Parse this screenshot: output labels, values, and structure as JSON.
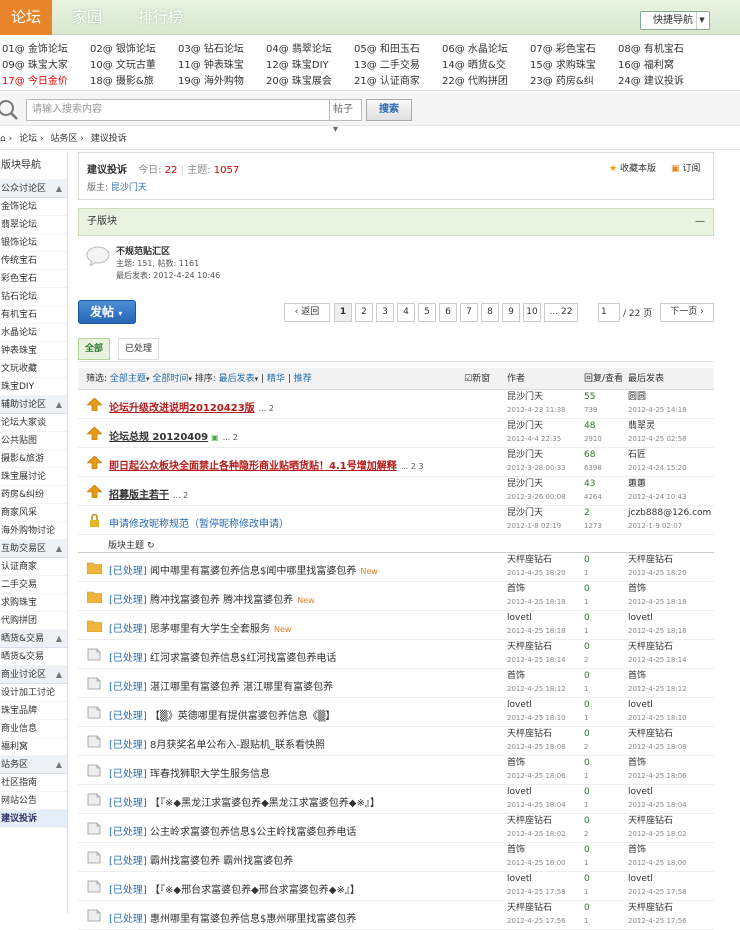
{
  "topnav": {
    "tabs": [
      "论坛",
      "家园",
      "排行榜"
    ],
    "quick_nav": "快捷导航"
  },
  "forum_grid": [
    [
      "01@ 金饰论坛",
      "02@ 银饰论坛",
      "03@ 钻石论坛",
      "04@ 翡翠论坛",
      "05@ 和田玉石",
      "06@ 水晶论坛",
      "07@ 彩色宝石",
      "08@ 有机宝石"
    ],
    [
      "09@ 珠宝大家",
      "10@ 文玩古董",
      "11@ 钟表珠宝",
      "12@ 珠宝DIY",
      "13@ 二手交易",
      "14@ 晒货&交",
      "15@ 求购珠宝",
      "16@ 福利窝"
    ],
    [
      "17@ 今日金价",
      "18@ 摄影&旅",
      "19@ 海外购物",
      "20@ 珠宝展会",
      "21@ 认证商家",
      "22@ 代购拼团",
      "23@ 药房&纠",
      "24@ 建议投诉"
    ]
  ],
  "search": {
    "placeholder": "请输入搜索内容",
    "select": "帖子",
    "button": "搜索"
  },
  "breadcrumb": [
    "论坛",
    "站务区",
    "建议投诉"
  ],
  "sidebar": [
    {
      "t": "版块导航",
      "k": "title"
    },
    {
      "t": "公众讨论区",
      "k": "head"
    },
    {
      "t": "金饰论坛"
    },
    {
      "t": "翡翠论坛"
    },
    {
      "t": "银饰论坛"
    },
    {
      "t": "传统宝石"
    },
    {
      "t": "彩色宝石"
    },
    {
      "t": "钻石论坛"
    },
    {
      "t": "有机宝石"
    },
    {
      "t": "水晶论坛"
    },
    {
      "t": "钟表珠宝"
    },
    {
      "t": "文玩收藏"
    },
    {
      "t": "珠宝DIY"
    },
    {
      "t": "辅助讨论区",
      "k": "head"
    },
    {
      "t": "论坛大家谈"
    },
    {
      "t": "公共贴图"
    },
    {
      "t": "摄影&旅游"
    },
    {
      "t": "珠宝展讨论"
    },
    {
      "t": "药房&纠纷"
    },
    {
      "t": "商家风采"
    },
    {
      "t": "海外购物讨论"
    },
    {
      "t": "互助交易区",
      "k": "head"
    },
    {
      "t": "认证商家"
    },
    {
      "t": "二手交易"
    },
    {
      "t": "求购珠宝"
    },
    {
      "t": "代购拼团"
    },
    {
      "t": "晒货&交易",
      "k": "head"
    },
    {
      "t": "晒货&交易"
    },
    {
      "t": "商业讨论区",
      "k": "head"
    },
    {
      "t": "设计加工讨论"
    },
    {
      "t": "珠宝品牌"
    },
    {
      "t": "商业信息"
    },
    {
      "t": "福利窝"
    },
    {
      "t": "站务区",
      "k": "head"
    },
    {
      "t": "社区指南"
    },
    {
      "t": "网站公告"
    },
    {
      "t": "建议投诉",
      "k": "sel"
    }
  ],
  "forum_info": {
    "title": "建议投诉",
    "today_label": "今日:",
    "today": "22",
    "topics_label": "主题:",
    "topics": "1057",
    "moderator_label": "版主:",
    "moderator": "昆沙门天",
    "favorite": "收藏本版",
    "subscribe": "订阅"
  },
  "subforum": {
    "header": "子版块",
    "name": "不规范贴汇区",
    "stats": "主题: 151, 帖数: 1161",
    "last": "最后发表: 2012-4-24 10:46"
  },
  "pager": {
    "post_button": "发帖",
    "back": "返回",
    "pages": [
      "1",
      "2",
      "3",
      "4",
      "5",
      "6",
      "7",
      "8",
      "9",
      "10",
      "... 22"
    ],
    "current_input": "1",
    "total": "/ 22 页",
    "next": "下一页"
  },
  "tabs": [
    "全部",
    "已处理"
  ],
  "table_header": {
    "filter": "筛选:",
    "all_topics": "全部主题",
    "all_time": "全部时间",
    "sort": "排序:",
    "sort_by": "最后发表",
    "digest": "精华",
    "recommend": "推荐",
    "new_window": "新窗",
    "author": "作者",
    "reply_view": "回复/查看",
    "last_post": "最后发表"
  },
  "sticky": [
    {
      "title": "论坛升级改进说明20120423版",
      "style": "stick",
      "pages": "... 2",
      "author": "昆沙门天",
      "date": "2012-4-23 11:38",
      "replies": "55",
      "views": "739",
      "last": "圆圆",
      "last_date": "2012-4-25 14:18"
    },
    {
      "title": "论坛总规 20120409",
      "style": "stick2",
      "pages": "... 2",
      "author": "昆沙门天",
      "date": "2012-4-4 22:35",
      "replies": "48",
      "views": "2910",
      "last": "翡翠灵",
      "last_date": "2012-4-25 02:58"
    },
    {
      "title": "即日起公众板块全面禁止各种隐形商业贴晒货贴！4.1号增加解释",
      "style": "stick",
      "pages": "... 2  3",
      "author": "昆沙门天",
      "date": "2012-3-28 00:33",
      "replies": "68",
      "views": "6398",
      "last": "石匠",
      "last_date": "2012-4-24 15:20"
    },
    {
      "title": "招募版主若干",
      "style": "stick2",
      "pages": "... 2",
      "author": "昆沙门天",
      "date": "2012-3-26 00:08",
      "replies": "43",
      "views": "4264",
      "last": "蕙蕙",
      "last_date": "2012-4-24 10:43"
    },
    {
      "title": "申请修改昵称规范（暂停昵称修改申请）",
      "style": "blueT",
      "pages": "",
      "author": "昆沙门天",
      "date": "2012-1-8 02:19",
      "replies": "2",
      "views": "1273",
      "last": "jczb888@126.com",
      "last_date": "2012-1-9 02:07"
    }
  ],
  "section_label": "版块主题",
  "threads": [
    {
      "cat": "[已处理]",
      "title": "闻中哪里有富婆包养信息$闻中哪里找富婆包养",
      "new": "New",
      "author": "天枰座钻石",
      "date": "2012-4-25 18:20",
      "replies": "0",
      "views": "1",
      "last": "天枰座钻石",
      "last_date": "2012-4-25 18:20",
      "hot": true
    },
    {
      "cat": "[已处理]",
      "title": "腾冲找富婆包养 腾冲找富婆包养",
      "new": "New",
      "author": "首饰",
      "date": "2012-4-25 18:18",
      "replies": "0",
      "views": "1",
      "last": "首饰",
      "last_date": "2012-4-25 18:18",
      "hot": true
    },
    {
      "cat": "[已处理]",
      "title": "思茅哪里有大学生全套服务",
      "new": "New",
      "author": "lovetl",
      "date": "2012-4-25 18:18",
      "replies": "0",
      "views": "1",
      "last": "lovetl",
      "last_date": "2012-4-25 18:18",
      "hot": true
    },
    {
      "cat": "[已处理]",
      "title": "红河求富婆包养信息$红河找富婆包养电话",
      "new": "",
      "author": "天枰座钻石",
      "date": "2012-4-25 18:14",
      "replies": "0",
      "views": "2",
      "last": "天枰座钻石",
      "last_date": "2012-4-25 18:14"
    },
    {
      "cat": "[已处理]",
      "title": "湛江哪里有富婆包养 湛江哪里有富婆包养",
      "new": "",
      "author": "首饰",
      "date": "2012-4-25 18:12",
      "replies": "0",
      "views": "1",
      "last": "首饰",
      "last_date": "2012-4-25 18:12"
    },
    {
      "cat": "[已处理]",
      "title": "【▒》英德哪里有提供富婆包养信息《▒】",
      "new": "",
      "author": "lovetl",
      "date": "2012-4-25 18:10",
      "replies": "0",
      "views": "1",
      "last": "lovetl",
      "last_date": "2012-4-25 18:10"
    },
    {
      "cat": "[已处理]",
      "title": "8月获奖名单公布入-跟贴机_联系看快照",
      "new": "",
      "author": "天枰座钻石",
      "date": "2012-4-25 18:08",
      "replies": "0",
      "views": "2",
      "last": "天枰座钻石",
      "last_date": "2012-4-25 18:08"
    },
    {
      "cat": "[已处理]",
      "title": "珲春找狮职大学生服务信息",
      "new": "",
      "author": "首饰",
      "date": "2012-4-25 18:06",
      "replies": "0",
      "views": "1",
      "last": "首饰",
      "last_date": "2012-4-25 18:06"
    },
    {
      "cat": "[已处理]",
      "title": "【『※◆黑龙江求富婆包养◆黑龙江求富婆包养◆※』】",
      "new": "",
      "author": "lovetl",
      "date": "2012-4-25 18:04",
      "replies": "0",
      "views": "1",
      "last": "lovetl",
      "last_date": "2012-4-25 18:04"
    },
    {
      "cat": "[已处理]",
      "title": "公主岭求富婆包养信息$公主岭找富婆包养电话",
      "new": "",
      "author": "天枰座钻石",
      "date": "2012-4-25 18:02",
      "replies": "0",
      "views": "2",
      "last": "天枰座钻石",
      "last_date": "2012-4-25 18:02"
    },
    {
      "cat": "[已处理]",
      "title": "霸州找富婆包养 霸州找富婆包养",
      "new": "",
      "author": "首饰",
      "date": "2012-4-25 18:00",
      "replies": "0",
      "views": "1",
      "last": "首饰",
      "last_date": "2012-4-25 18:00"
    },
    {
      "cat": "[已处理]",
      "title": "【『※◆邢台求富婆包养◆邢台求富婆包养◆※』】",
      "new": "",
      "author": "lovetl",
      "date": "2012-4-25 17:58",
      "replies": "0",
      "views": "1",
      "last": "lovetl",
      "last_date": "2012-4-25 17:58"
    },
    {
      "cat": "[已处理]",
      "title": "惠州哪里有富婆包养信息$惠州哪里找富婆包养",
      "new": "",
      "author": "天枰座钻石",
      "date": "2012-4-25 17:56",
      "replies": "0",
      "views": "1",
      "last": "天枰座钻石",
      "last_date": "2012-4-25 17:56"
    }
  ]
}
